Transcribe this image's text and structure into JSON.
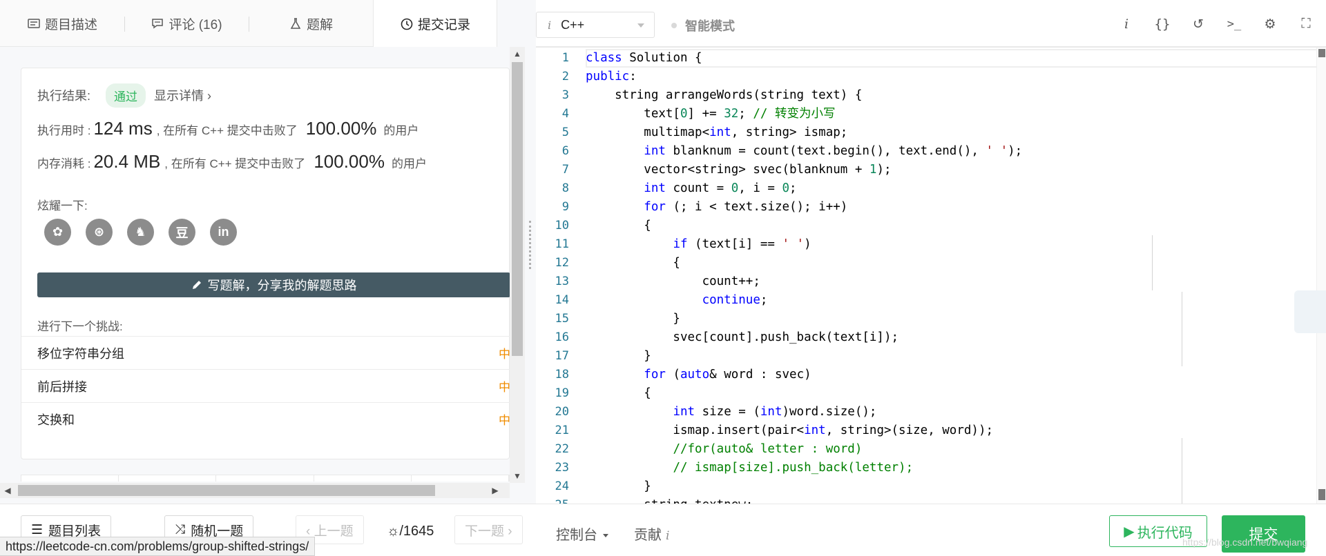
{
  "tabs": [
    {
      "label": "题目描述",
      "icon": "description-icon"
    },
    {
      "label": "评论 (16)",
      "icon": "comment-icon"
    },
    {
      "label": "题解",
      "icon": "flask-icon"
    },
    {
      "label": "提交记录",
      "icon": "clock-icon"
    }
  ],
  "result": {
    "label": "执行结果:",
    "status": "通过",
    "detail_link": "显示详情 ›",
    "runtime_label": "执行用时 :",
    "runtime_value": "124 ms",
    "runtime_mid": ", 在所有 C++ 提交中击败了",
    "runtime_pct": "100.00%",
    "runtime_suffix": "的用户",
    "memory_label": "内存消耗 :",
    "memory_value": "20.4 MB",
    "memory_mid": ", 在所有 C++ 提交中击败了",
    "memory_pct": "100.00%",
    "memory_suffix": "的用户",
    "share_label": "炫耀一下:",
    "share_icons": [
      "wechat-icon",
      "weibo-icon",
      "qq-icon",
      "douban-icon",
      "linkedin-icon"
    ],
    "share_glyphs": [
      "✿",
      "⊛",
      "♞",
      "豆",
      "in"
    ],
    "write_button": "写题解，分享我的解题思路",
    "next_label": "进行下一个挑战:",
    "next_problems": [
      {
        "title": "移位字符串分组",
        "difficulty": "中"
      },
      {
        "title": "前后拼接",
        "difficulty": "中"
      },
      {
        "title": "交换和",
        "difficulty": "中"
      }
    ]
  },
  "toolbar": {
    "language": "C++",
    "smart_mode": "智能模式"
  },
  "code": {
    "line_numbers": [
      "1",
      "2",
      "3",
      "4",
      "5",
      "6",
      "7",
      "8",
      "9",
      "10",
      "11",
      "12",
      "13",
      "14",
      "15",
      "16",
      "17",
      "18",
      "19",
      "20",
      "21",
      "22",
      "23",
      "24",
      "25"
    ]
  },
  "bottom": {
    "problem_list": "题目列表",
    "random": "随机一题",
    "prev": "‹ 上一题",
    "page_count": "/1645",
    "next": "下一题 ›",
    "console": "控制台",
    "contribute": "贡献",
    "run": "执行代码",
    "submit": "提交",
    "status_url": "https://leetcode-cn.com/problems/group-shifted-strings/",
    "watermark": "https://blog.csdn.net/bwqiang"
  },
  "colors": {
    "accent_green": "#2db55d",
    "dark_button": "#455a64",
    "keyword_blue": "#0000ff",
    "number_green": "#098658",
    "string_red": "#a31515",
    "comment_green": "#008000",
    "difficulty_orange": "#f08c00"
  }
}
